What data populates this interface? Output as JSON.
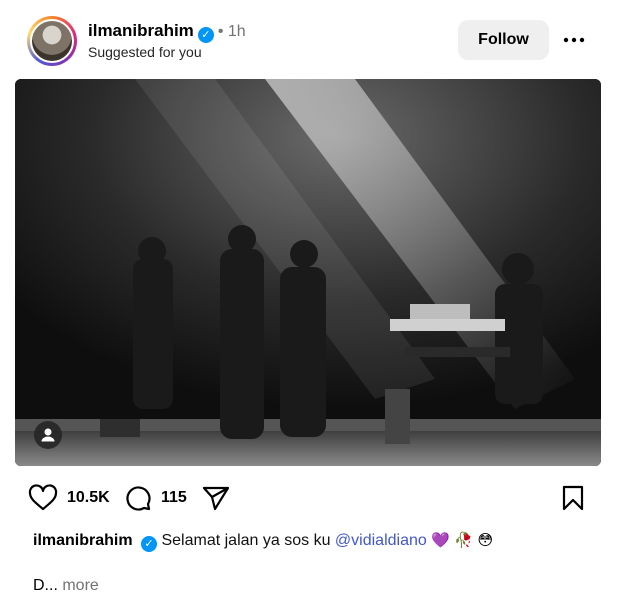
{
  "post": {
    "username": "ilmanibrahim",
    "separator": "•",
    "time": "1h",
    "suggestion": "Suggested for you",
    "follow_label": "Follow",
    "likes": "10.5K",
    "comments": "115",
    "caption": {
      "username": "ilmanibrahim",
      "text": "Selamat jalan ya sos ku",
      "mention": "@vidialdiano",
      "emojis": [
        "💜",
        "🥀",
        "😳"
      ],
      "truncated": "D...",
      "more_label": "more"
    }
  },
  "colors": {
    "verified": "#0095f6",
    "mention": "#4258c8",
    "follow_bg": "#efefef",
    "muted": "#737373"
  },
  "icons": {
    "verified": "verified-badge-icon",
    "more": "more-options-icon",
    "like": "heart-icon",
    "comment": "comment-icon",
    "share": "send-icon",
    "save": "bookmark-icon",
    "tags": "user-tag-icon"
  }
}
